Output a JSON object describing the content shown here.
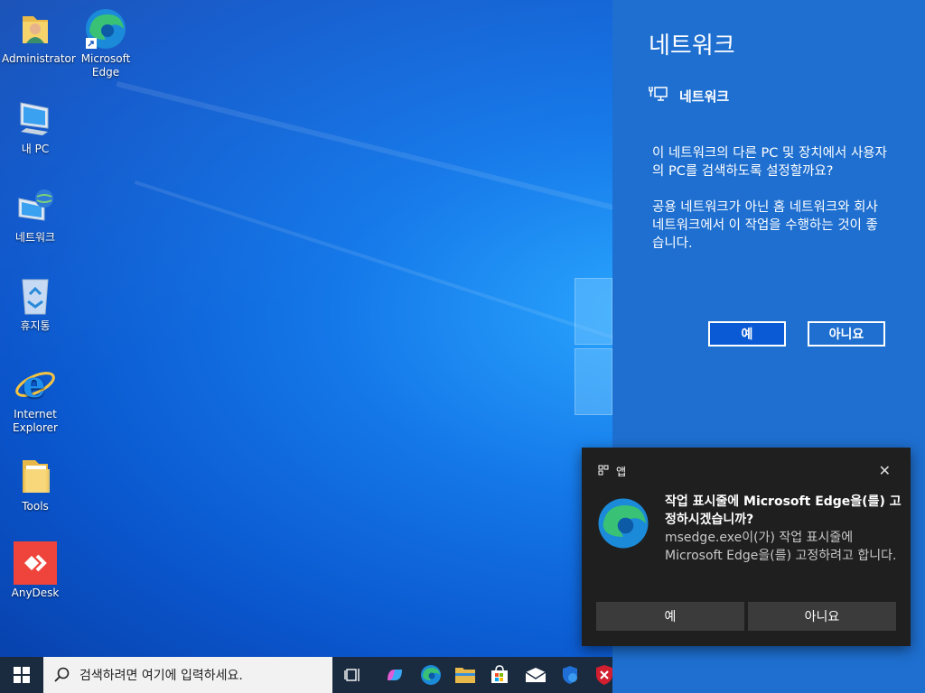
{
  "desktop_icons": [
    {
      "label": "Administrator",
      "icon": "user-folder-icon"
    },
    {
      "label": "Microsoft\nEdge",
      "icon": "edge-icon"
    },
    {
      "label": "내 PC",
      "icon": "computer-icon"
    },
    {
      "label": "네트워크",
      "icon": "network-icon"
    },
    {
      "label": "휴지통",
      "icon": "recycle-bin-icon"
    },
    {
      "label": "Internet\nExplorer",
      "icon": "internet-explorer-icon"
    },
    {
      "label": "Tools",
      "icon": "folder-icon"
    },
    {
      "label": "AnyDesk",
      "icon": "anydesk-icon"
    }
  ],
  "network_panel": {
    "title": "네트워크",
    "subhead": "네트워크",
    "message": "이 네트워크의 다른 PC 및 장치에서 사용자의 PC를 검색하도록 설정할까요?\n\n공용 네트워크가 아닌 홈 네트워크와 회사 네트워크에서 이 작업을 수행하는 것이 좋습니다.",
    "yes_label": "예",
    "no_label": "아니요"
  },
  "toast": {
    "app_label": "앱",
    "headline": "작업 표시줄에 Microsoft Edge을(를) 고정하시겠습니까?",
    "body": "msedge.exe이(가) 작업 표시줄에 Microsoft Edge을(를) 고정하려고 합니다.",
    "yes_label": "예",
    "no_label": "아니요"
  },
  "taskbar": {
    "search_placeholder": "검색하려면 여기에 입력하세요.",
    "icons": [
      "task-view-icon",
      "copilot-icon",
      "edge-icon",
      "file-explorer-icon",
      "microsoft-store-icon",
      "mail-icon",
      "defender-icon",
      "security-alert-icon"
    ]
  },
  "colors": {
    "panel_bg": "#1e6fd0",
    "toast_bg": "#1f1f1f",
    "taskbar_bg": "#1b2b3f"
  }
}
